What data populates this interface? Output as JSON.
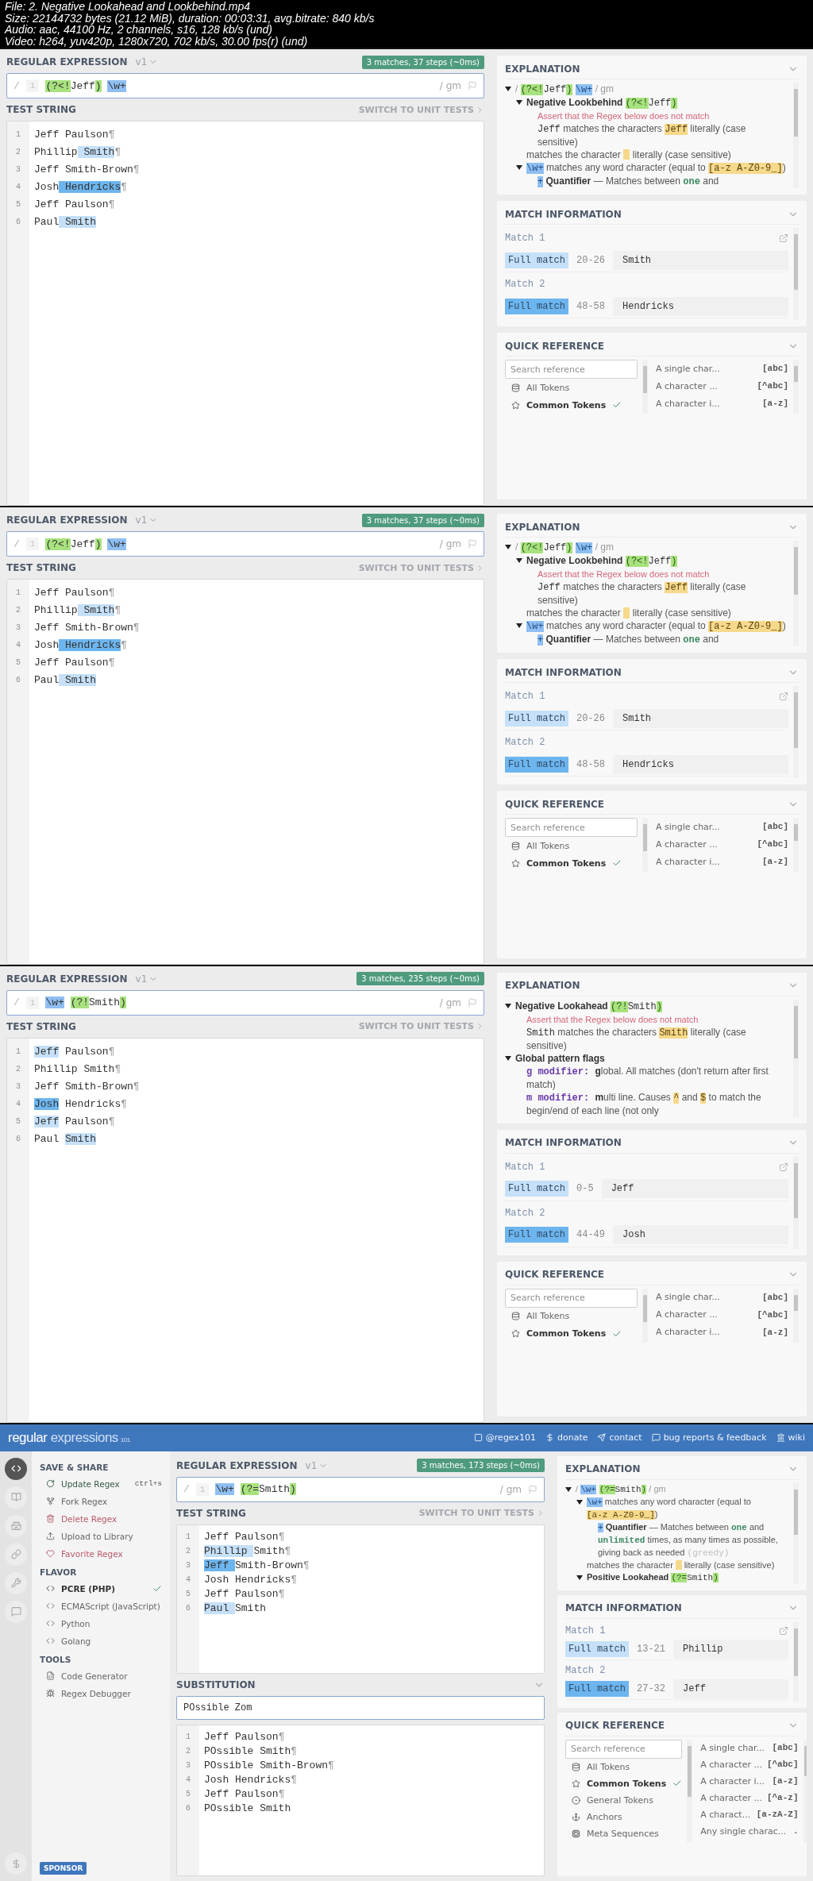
{
  "file_info": [
    "File: 2. Negative Lookahead and Lookbehind.mp4",
    "Size: 22144732 bytes (21.12 MiB), duration: 00:03:31, avg.bitrate: 840 kb/s",
    "Audio: aac, 44100 Hz, 2 channels, s16, 128 kb/s (und)",
    "Video: h264, yuv420p, 1280x720, 702 kb/s, 30.00 fps(r) (und)"
  ],
  "frames": [
    {
      "kind": "compact",
      "regex_panel": {
        "title": "REGULAR EXPRESSION",
        "version": "v1",
        "badge": "3 matches, 37 steps (~0ms)",
        "delimiter": "/",
        "line_number": "1",
        "flags": "/ gm",
        "tokens": [
          {
            "text": "(?<!",
            "kind": "group"
          },
          {
            "text": "Jeff",
            "kind": "plain"
          },
          {
            "text": ")",
            "kind": "group"
          },
          {
            "text": "\\w+",
            "kind": "class",
            "space_before": true
          }
        ],
        "test_title": "TEST STRING",
        "switch_label": "SWITCH TO UNIT TESTS",
        "lines": [
          {
            "number": "1",
            "segments": [
              {
                "text": "Jeff Paulson",
                "kind": "plain"
              },
              {
                "text": "¶",
                "kind": "eol"
              }
            ]
          },
          {
            "number": "2",
            "segments": [
              {
                "text": "Phillip",
                "kind": "plain"
              },
              {
                "text": " Smith",
                "kind": "match-a"
              },
              {
                "text": "¶",
                "kind": "eol"
              }
            ]
          },
          {
            "number": "3",
            "segments": [
              {
                "text": "Jeff Smith-Brown",
                "kind": "plain"
              },
              {
                "text": "¶",
                "kind": "eol"
              }
            ]
          },
          {
            "number": "4",
            "segments": [
              {
                "text": "Josh",
                "kind": "plain"
              },
              {
                "text": " Hendricks",
                "kind": "match-b"
              },
              {
                "text": "¶",
                "kind": "eol"
              }
            ]
          },
          {
            "number": "5",
            "segments": [
              {
                "text": "Jeff Paulson",
                "kind": "plain"
              },
              {
                "text": "¶",
                "kind": "eol"
              }
            ]
          },
          {
            "number": "6",
            "segments": [
              {
                "text": "Paul",
                "kind": "plain"
              },
              {
                "text": " Smith",
                "kind": "match-a"
              }
            ]
          }
        ]
      },
      "explanation": {
        "title": "EXPLANATION",
        "nodes": [
          {
            "expanded": true,
            "parts": [
              {
                "text": "/ ",
                "kind": "delim"
              },
              {
                "text": "(?<!",
                "kind": "group"
              },
              {
                "text": "Jeff",
                "kind": "code"
              },
              {
                "text": ")",
                "kind": "group"
              },
              {
                "text": "\\w+",
                "kind": "class",
                "space_before": true
              },
              {
                "text": " / gm",
                "kind": "delim"
              }
            ],
            "children": [
              {
                "expanded": true,
                "parts": [
                  {
                    "text": "Negative Lookbehind ",
                    "kind": "bold"
                  },
                  {
                    "text": "(?<!",
                    "kind": "group"
                  },
                  {
                    "text": "Jeff",
                    "kind": "code"
                  },
                  {
                    "text": ")",
                    "kind": "group"
                  }
                ],
                "children": [
                  {
                    "parts": [
                      {
                        "text": "Assert that the Regex below does not match",
                        "kind": "hint"
                      }
                    ]
                  },
                  {
                    "parts": [
                      {
                        "text": "Jeff",
                        "kind": "code"
                      },
                      {
                        "text": " matches the characters ",
                        "kind": "text"
                      },
                      {
                        "text": "Jeff",
                        "kind": "literal"
                      },
                      {
                        "text": " literally (case sensitive)",
                        "kind": "text"
                      }
                    ]
                  }
                ]
              },
              {
                "parts": [
                  {
                    "text": "matches the character ",
                    "kind": "text"
                  },
                  {
                    "kind": "blank"
                  },
                  {
                    "text": " literally (case sensitive)",
                    "kind": "text"
                  }
                ]
              },
              {
                "expanded": true,
                "parts": [
                  {
                    "text": "\\w+",
                    "kind": "class"
                  },
                  {
                    "text": " matches any word character (equal to ",
                    "kind": "text"
                  },
                  {
                    "text": "[a-z A-Z0-9_]",
                    "kind": "literal"
                  },
                  {
                    "text": ")",
                    "kind": "text"
                  }
                ],
                "children": [
                  {
                    "parts": [
                      {
                        "text": "+",
                        "kind": "class"
                      },
                      {
                        "text": " Quantifier",
                        "kind": "bold"
                      },
                      {
                        "text": " — Matches between ",
                        "kind": "text"
                      },
                      {
                        "text": "one",
                        "kind": "num"
                      },
                      {
                        "text": " and",
                        "kind": "text"
                      }
                    ]
                  }
                ]
              }
            ]
          }
        ]
      },
      "match_information": {
        "title": "MATCH INFORMATION",
        "matches": [
          {
            "label": "Match 1",
            "tag": "Full match",
            "range": "20-26",
            "value": "Smith",
            "color": "#c5e0f8"
          },
          {
            "label": "Match 2",
            "tag": "Full match",
            "range": "48-58",
            "value": "Hendricks",
            "color": "#6db5ee"
          }
        ]
      },
      "quick_reference": {
        "title": "QUICK REFERENCE",
        "placeholder": "Search reference",
        "categories": [
          {
            "kind": "all",
            "label": "All Tokens",
            "selected": false
          },
          {
            "kind": "common",
            "label": "Common Tokens",
            "selected": true
          }
        ],
        "tokens": [
          {
            "description": "A single char...",
            "token": "[abc]"
          },
          {
            "description": "A character ...",
            "token": "[^abc]"
          },
          {
            "description": "A character i...",
            "token": "[a-z]"
          }
        ]
      }
    },
    {
      "kind": "compact",
      "regex_panel": {
        "title": "REGULAR EXPRESSION",
        "version": "v1",
        "badge": "3 matches, 37 steps (~0ms)",
        "delimiter": "/",
        "line_number": "1",
        "flags": "/ gm",
        "tokens": [
          {
            "text": "(?<!",
            "kind": "group"
          },
          {
            "text": "Jeff",
            "kind": "plain"
          },
          {
            "text": ")",
            "kind": "group"
          },
          {
            "text": "\\w+",
            "kind": "class",
            "space_before": true
          }
        ],
        "test_title": "TEST STRING",
        "switch_label": "SWITCH TO UNIT TESTS",
        "lines": [
          {
            "number": "1",
            "segments": [
              {
                "text": "Jeff Paulson",
                "kind": "plain"
              },
              {
                "text": "¶",
                "kind": "eol"
              }
            ]
          },
          {
            "number": "2",
            "segments": [
              {
                "text": "Phillip",
                "kind": "plain"
              },
              {
                "text": " Smith",
                "kind": "match-a"
              },
              {
                "text": "¶",
                "kind": "eol"
              }
            ]
          },
          {
            "number": "3",
            "segments": [
              {
                "text": "Jeff Smith-Brown",
                "kind": "plain"
              },
              {
                "text": "¶",
                "kind": "eol"
              }
            ]
          },
          {
            "number": "4",
            "segments": [
              {
                "text": "Josh",
                "kind": "plain"
              },
              {
                "text": " Hendricks",
                "kind": "match-b"
              },
              {
                "text": "¶",
                "kind": "eol"
              }
            ]
          },
          {
            "number": "5",
            "segments": [
              {
                "text": "Jeff Paulson",
                "kind": "plain"
              },
              {
                "text": "¶",
                "kind": "eol"
              }
            ]
          },
          {
            "number": "6",
            "segments": [
              {
                "text": "Paul",
                "kind": "plain"
              },
              {
                "text": " Smith",
                "kind": "match-a"
              }
            ]
          }
        ]
      },
      "explanation": {
        "title": "EXPLANATION",
        "nodes": [
          {
            "expanded": true,
            "parts": [
              {
                "text": "/ ",
                "kind": "delim"
              },
              {
                "text": "(?<!",
                "kind": "group"
              },
              {
                "text": "Jeff",
                "kind": "code"
              },
              {
                "text": ")",
                "kind": "group"
              },
              {
                "text": "\\w+",
                "kind": "class",
                "space_before": true
              },
              {
                "text": " / gm",
                "kind": "delim"
              }
            ],
            "children": [
              {
                "expanded": true,
                "parts": [
                  {
                    "text": "Negative Lookbehind ",
                    "kind": "bold"
                  },
                  {
                    "text": "(?<!",
                    "kind": "group"
                  },
                  {
                    "text": "Jeff",
                    "kind": "code"
                  },
                  {
                    "text": ")",
                    "kind": "group"
                  }
                ],
                "children": [
                  {
                    "parts": [
                      {
                        "text": "Assert that the Regex below does not match",
                        "kind": "hint"
                      }
                    ]
                  },
                  {
                    "parts": [
                      {
                        "text": "Jeff",
                        "kind": "code"
                      },
                      {
                        "text": " matches the characters ",
                        "kind": "text"
                      },
                      {
                        "text": "Jeff",
                        "kind": "literal"
                      },
                      {
                        "text": " literally (case sensitive)",
                        "kind": "text"
                      }
                    ]
                  }
                ]
              },
              {
                "parts": [
                  {
                    "text": "matches the character ",
                    "kind": "text"
                  },
                  {
                    "kind": "blank"
                  },
                  {
                    "text": " literally (case sensitive)",
                    "kind": "text"
                  }
                ]
              },
              {
                "expanded": true,
                "parts": [
                  {
                    "text": "\\w+",
                    "kind": "class"
                  },
                  {
                    "text": " matches any word character (equal to ",
                    "kind": "text"
                  },
                  {
                    "text": "[a-z A-Z0-9_]",
                    "kind": "literal"
                  },
                  {
                    "text": ")",
                    "kind": "text"
                  }
                ],
                "children": [
                  {
                    "parts": [
                      {
                        "text": "+",
                        "kind": "class"
                      },
                      {
                        "text": " Quantifier",
                        "kind": "bold"
                      },
                      {
                        "text": " — Matches between ",
                        "kind": "text"
                      },
                      {
                        "text": "one",
                        "kind": "num"
                      },
                      {
                        "text": " and",
                        "kind": "text"
                      }
                    ]
                  }
                ]
              }
            ]
          }
        ]
      },
      "match_information": {
        "title": "MATCH INFORMATION",
        "matches": [
          {
            "label": "Match 1",
            "tag": "Full match",
            "range": "20-26",
            "value": "Smith",
            "color": "#c5e0f8"
          },
          {
            "label": "Match 2",
            "tag": "Full match",
            "range": "48-58",
            "value": "Hendricks",
            "color": "#6db5ee"
          }
        ]
      },
      "quick_reference": {
        "title": "QUICK REFERENCE",
        "placeholder": "Search reference",
        "categories": [
          {
            "kind": "all",
            "label": "All Tokens",
            "selected": false
          },
          {
            "kind": "common",
            "label": "Common Tokens",
            "selected": true
          }
        ],
        "tokens": [
          {
            "description": "A single char...",
            "token": "[abc]"
          },
          {
            "description": "A character ...",
            "token": "[^abc]"
          },
          {
            "description": "A character i...",
            "token": "[a-z]"
          }
        ]
      }
    },
    {
      "kind": "compact",
      "regex_panel": {
        "title": "REGULAR EXPRESSION",
        "version": "v1",
        "badge": "3 matches, 235 steps (~0ms)",
        "delimiter": "/",
        "line_number": "1",
        "flags": "/ gm",
        "tokens": [
          {
            "text": "\\w+",
            "kind": "class"
          },
          {
            "text": "(?!",
            "kind": "group",
            "space_before": true
          },
          {
            "text": "Smith",
            "kind": "plain"
          },
          {
            "text": ")",
            "kind": "group"
          }
        ],
        "test_title": "TEST STRING",
        "switch_label": "SWITCH TO UNIT TESTS",
        "lines": [
          {
            "number": "1",
            "segments": [
              {
                "text": "Jeff",
                "kind": "match-a"
              },
              {
                "text": " Paulson",
                "kind": "plain"
              },
              {
                "text": "¶",
                "kind": "eol"
              }
            ]
          },
          {
            "number": "2",
            "segments": [
              {
                "text": "Phillip Smith",
                "kind": "plain"
              },
              {
                "text": "¶",
                "kind": "eol"
              }
            ]
          },
          {
            "number": "3",
            "segments": [
              {
                "text": "Jeff Smith-Brown",
                "kind": "plain"
              },
              {
                "text": "¶",
                "kind": "eol"
              }
            ]
          },
          {
            "number": "4",
            "segments": [
              {
                "text": "Josh",
                "kind": "match-b"
              },
              {
                "text": " Hendricks",
                "kind": "plain"
              },
              {
                "text": "¶",
                "kind": "eol"
              }
            ]
          },
          {
            "number": "5",
            "segments": [
              {
                "text": "Jeff",
                "kind": "match-a"
              },
              {
                "text": " Paulson",
                "kind": "plain"
              },
              {
                "text": "¶",
                "kind": "eol"
              }
            ]
          },
          {
            "number": "6",
            "segments": [
              {
                "text": "Paul ",
                "kind": "plain"
              },
              {
                "text": "Smith",
                "kind": "match-a"
              }
            ]
          }
        ]
      },
      "explanation": {
        "title": "EXPLANATION",
        "nodes": [
          {
            "expanded": true,
            "parts": [
              {
                "text": "Negative Lookahead ",
                "kind": "bold"
              },
              {
                "text": "(?!",
                "kind": "group"
              },
              {
                "text": "Smith",
                "kind": "code"
              },
              {
                "text": ")",
                "kind": "group"
              }
            ],
            "children": [
              {
                "parts": [
                  {
                    "text": "Assert that the Regex below does not match",
                    "kind": "hint"
                  }
                ]
              },
              {
                "parts": [
                  {
                    "text": "Smith",
                    "kind": "code"
                  },
                  {
                    "text": " matches the characters ",
                    "kind": "text"
                  },
                  {
                    "text": "Smith",
                    "kind": "literal"
                  },
                  {
                    "text": " literally (case sensitive)",
                    "kind": "text"
                  }
                ]
              }
            ]
          },
          {
            "expanded": true,
            "parts": [
              {
                "text": "Global pattern flags",
                "kind": "bold"
              }
            ],
            "children": [
              {
                "parts": [
                  {
                    "text": "g modifier: ",
                    "kind": "flag"
                  },
                  {
                    "text": "g",
                    "kind": "bold"
                  },
                  {
                    "text": "lobal. All matches (don't return after first match)",
                    "kind": "text"
                  }
                ]
              },
              {
                "parts": [
                  {
                    "text": "m modifier: ",
                    "kind": "flag"
                  },
                  {
                    "text": "m",
                    "kind": "bold"
                  },
                  {
                    "text": "ulti line. Causes ",
                    "kind": "text"
                  },
                  {
                    "text": "^",
                    "kind": "literal"
                  },
                  {
                    "text": " and ",
                    "kind": "text"
                  },
                  {
                    "text": "$",
                    "kind": "literal"
                  },
                  {
                    "text": " to match the begin/end of each line (not only",
                    "kind": "text"
                  }
                ]
              }
            ]
          }
        ]
      },
      "match_information": {
        "title": "MATCH INFORMATION",
        "matches": [
          {
            "label": "Match 1",
            "tag": "Full match",
            "range": "0-5",
            "value": "Jeff",
            "color": "#c5e0f8"
          },
          {
            "label": "Match 2",
            "tag": "Full match",
            "range": "44-49",
            "value": "Josh",
            "color": "#6db5ee"
          }
        ]
      },
      "quick_reference": {
        "title": "QUICK REFERENCE",
        "placeholder": "Search reference",
        "categories": [
          {
            "kind": "all",
            "label": "All Tokens",
            "selected": false
          },
          {
            "kind": "common",
            "label": "Common Tokens",
            "selected": true
          }
        ],
        "tokens": [
          {
            "description": "A single char...",
            "token": "[abc]"
          },
          {
            "description": "A character ...",
            "token": "[^abc]"
          },
          {
            "description": "A character i...",
            "token": "[a-z]"
          }
        ]
      }
    },
    {
      "kind": "full",
      "topbar": {
        "logo": [
          {
            "text": "regular",
            "kind": "strong"
          },
          {
            "text": " expressions",
            "kind": "light"
          },
          {
            "text": "101",
            "kind": "small"
          }
        ],
        "links": [
          {
            "kind": "twitter",
            "label": "@regex101"
          },
          {
            "kind": "dollar",
            "label": "donate"
          },
          {
            "kind": "send",
            "label": "contact"
          },
          {
            "kind": "message",
            "label": "bug reports & feedback"
          },
          {
            "kind": "bank",
            "label": "wiki"
          }
        ]
      },
      "rail": [
        {
          "kind": "code",
          "selected": true
        },
        {
          "kind": "book",
          "selected": false
        },
        {
          "kind": "castle",
          "selected": false
        },
        {
          "kind": "link",
          "selected": false
        },
        {
          "kind": "wrench",
          "selected": false
        },
        {
          "kind": "chat",
          "selected": false
        },
        {
          "kind": "dollar",
          "selected": false
        }
      ],
      "sidebar": {
        "sections": [
          {
            "title": "SAVE & SHARE",
            "items": [
              {
                "kind": "refresh",
                "label": "Update Regex",
                "shortcut": "ctrl+s",
                "color": "#3a5a47"
              },
              {
                "kind": "fork",
                "label": "Fork Regex",
                "color": "#666666"
              },
              {
                "kind": "trash",
                "label": "Delete Regex",
                "color": "#b85a6a"
              },
              {
                "kind": "upload",
                "label": "Upload to Library",
                "color": "#666666"
              },
              {
                "kind": "heart",
                "label": "Favorite Regex",
                "color": "#b85a6a"
              }
            ]
          },
          {
            "title": "FLAVOR",
            "items": [
              {
                "kind": "code",
                "label": "PCRE (PHP)",
                "selected": true
              },
              {
                "kind": "code",
                "label": "ECMAScript (JavaScript)",
                "selected": false
              },
              {
                "kind": "code",
                "label": "Python",
                "selected": false
              },
              {
                "kind": "code",
                "label": "Golang",
                "selected": false
              }
            ]
          },
          {
            "title": "TOOLS",
            "items": [
              {
                "kind": "file-code",
                "label": "Code Generator",
                "color": "#666666"
              },
              {
                "kind": "bug",
                "label": "Regex Debugger",
                "color": "#666666"
              }
            ]
          }
        ],
        "sponsor": "SPONSOR"
      },
      "regex_panel": {
        "title": "REGULAR EXPRESSION",
        "version": "v1",
        "badge": "3 matches, 173 steps (~0ms)",
        "delimiter": "/",
        "line_number": "1",
        "flags": "/ gm",
        "tokens": [
          {
            "text": "\\w+",
            "kind": "class"
          },
          {
            "text": "(?=",
            "kind": "group",
            "space_before": true
          },
          {
            "text": "Smith",
            "kind": "plain"
          },
          {
            "text": ")",
            "kind": "group"
          }
        ],
        "test_title": "TEST STRING",
        "switch_label": "SWITCH TO UNIT TESTS",
        "lines": [
          {
            "number": "1",
            "segments": [
              {
                "text": "Jeff Paulson",
                "kind": "plain"
              },
              {
                "text": "¶",
                "kind": "eol"
              }
            ]
          },
          {
            "number": "2",
            "segments": [
              {
                "text": "Phillip ",
                "kind": "match-a"
              },
              {
                "text": "Smith",
                "kind": "plain"
              },
              {
                "text": "¶",
                "kind": "eol"
              }
            ]
          },
          {
            "number": "3",
            "segments": [
              {
                "text": "Jeff ",
                "kind": "match-b"
              },
              {
                "text": "Smith-Brown",
                "kind": "plain"
              },
              {
                "text": "¶",
                "kind": "eol"
              }
            ]
          },
          {
            "number": "4",
            "segments": [
              {
                "text": "Josh Hendricks",
                "kind": "plain"
              },
              {
                "text": "¶",
                "kind": "eol"
              }
            ]
          },
          {
            "number": "5",
            "segments": [
              {
                "text": "Jeff Paulson",
                "kind": "plain"
              },
              {
                "text": "¶",
                "kind": "eol"
              }
            ]
          },
          {
            "number": "6",
            "segments": [
              {
                "text": "Paul ",
                "kind": "match-a"
              },
              {
                "text": "Smith",
                "kind": "plain"
              }
            ]
          }
        ]
      },
      "substitution": {
        "title": "SUBSTITUTION",
        "value": "POssible Zom",
        "lines": [
          {
            "number": "1",
            "segments": [
              {
                "text": "Jeff Paulson",
                "kind": "plain"
              },
              {
                "text": "¶",
                "kind": "eol"
              }
            ]
          },
          {
            "number": "2",
            "segments": [
              {
                "text": "POssible Smith",
                "kind": "plain"
              },
              {
                "text": "¶",
                "kind": "eol"
              }
            ]
          },
          {
            "number": "3",
            "segments": [
              {
                "text": "POssible Smith-Brown",
                "kind": "plain"
              },
              {
                "text": "¶",
                "kind": "eol"
              }
            ]
          },
          {
            "number": "4",
            "segments": [
              {
                "text": "Josh Hendricks",
                "kind": "plain"
              },
              {
                "text": "¶",
                "kind": "eol"
              }
            ]
          },
          {
            "number": "5",
            "segments": [
              {
                "text": "Jeff Paulson",
                "kind": "plain"
              },
              {
                "text": "¶",
                "kind": "eol"
              }
            ]
          },
          {
            "number": "6",
            "segments": [
              {
                "text": "POssible Smith",
                "kind": "plain"
              }
            ]
          }
        ]
      },
      "explanation": {
        "title": "EXPLANATION",
        "nodes": [
          {
            "expanded": true,
            "parts": [
              {
                "text": "/ ",
                "kind": "delim"
              },
              {
                "text": "\\w+",
                "kind": "class"
              },
              {
                "text": "(?=",
                "kind": "group",
                "space_before": true
              },
              {
                "text": "Smith",
                "kind": "code"
              },
              {
                "text": ")",
                "kind": "group"
              },
              {
                "text": " / gm",
                "kind": "delim"
              }
            ],
            "children": [
              {
                "expanded": true,
                "parts": [
                  {
                    "text": "\\w+",
                    "kind": "class"
                  },
                  {
                    "text": " matches any word character (equal to ",
                    "kind": "text"
                  },
                  {
                    "text": "[a-z A-Z0-9_]",
                    "kind": "literal"
                  },
                  {
                    "text": ")",
                    "kind": "text"
                  }
                ],
                "children": [
                  {
                    "parts": [
                      {
                        "text": "+",
                        "kind": "class"
                      },
                      {
                        "text": " Quantifier",
                        "kind": "bold"
                      },
                      {
                        "text": " — Matches between ",
                        "kind": "text"
                      },
                      {
                        "text": "one",
                        "kind": "num"
                      },
                      {
                        "text": " and ",
                        "kind": "text"
                      },
                      {
                        "text": "unlimited",
                        "kind": "num"
                      },
                      {
                        "text": " times, as many times as possible, giving back as needed ",
                        "kind": "text"
                      },
                      {
                        "text": "(greedy)",
                        "kind": "muted"
                      }
                    ]
                  }
                ]
              },
              {
                "parts": [
                  {
                    "text": "matches the character ",
                    "kind": "text"
                  },
                  {
                    "kind": "blank"
                  },
                  {
                    "text": " literally (case sensitive)",
                    "kind": "text"
                  }
                ]
              },
              {
                "expanded": true,
                "parts": [
                  {
                    "text": "Positive Lookahead ",
                    "kind": "bold"
                  },
                  {
                    "text": "(?=",
                    "kind": "group"
                  },
                  {
                    "text": "Smith",
                    "kind": "code"
                  },
                  {
                    "text": ")",
                    "kind": "group"
                  }
                ]
              }
            ]
          }
        ]
      },
      "match_information": {
        "title": "MATCH INFORMATION",
        "matches": [
          {
            "label": "Match 1",
            "tag": "Full match",
            "range": "13-21",
            "value": "Phillip",
            "color": "#c5e0f8"
          },
          {
            "label": "Match 2",
            "tag": "Full match",
            "range": "27-32",
            "value": "Jeff",
            "color": "#6db5ee"
          }
        ]
      },
      "quick_reference": {
        "title": "QUICK REFERENCE",
        "placeholder": "Search reference",
        "categories": [
          {
            "kind": "all",
            "label": "All Tokens",
            "selected": false
          },
          {
            "kind": "common",
            "label": "Common Tokens",
            "selected": true
          },
          {
            "kind": "general",
            "label": "General Tokens",
            "selected": false
          },
          {
            "kind": "anchors",
            "label": "Anchors",
            "selected": false
          },
          {
            "kind": "meta",
            "label": "Meta Sequences",
            "selected": false
          }
        ],
        "tokens": [
          {
            "description": "A single char...",
            "token": "[abc]"
          },
          {
            "description": "A character ...",
            "token": "[^abc]"
          },
          {
            "description": "A character i...",
            "token": "[a-z]"
          },
          {
            "description": "A character ...",
            "token": "[^a-z]"
          },
          {
            "description": "A charact...",
            "token": "[a-zA-Z]"
          },
          {
            "description": "Any single charac...",
            "token": "."
          }
        ]
      }
    }
  ]
}
